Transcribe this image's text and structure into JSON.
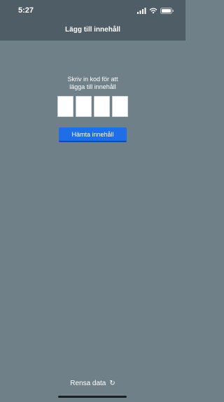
{
  "status_bar": {
    "time": "5:27",
    "icons": [
      "signal-icon",
      "wifi-icon",
      "battery-icon"
    ]
  },
  "nav": {
    "title": "Lägg till innehåll"
  },
  "code_entry": {
    "prompt_line1": "Skriv in kod för att",
    "prompt_line2": "lägga till innehåll",
    "box_count": 4
  },
  "fetch_button": {
    "label": "Hämta innehåll"
  },
  "footer": {
    "clear_label": "Rensa data",
    "clear_icon": "refresh-icon"
  },
  "colors": {
    "background": "#708088",
    "topbar": "#4f5d66",
    "button": "#1e6ee8",
    "text": "#ffffff"
  }
}
